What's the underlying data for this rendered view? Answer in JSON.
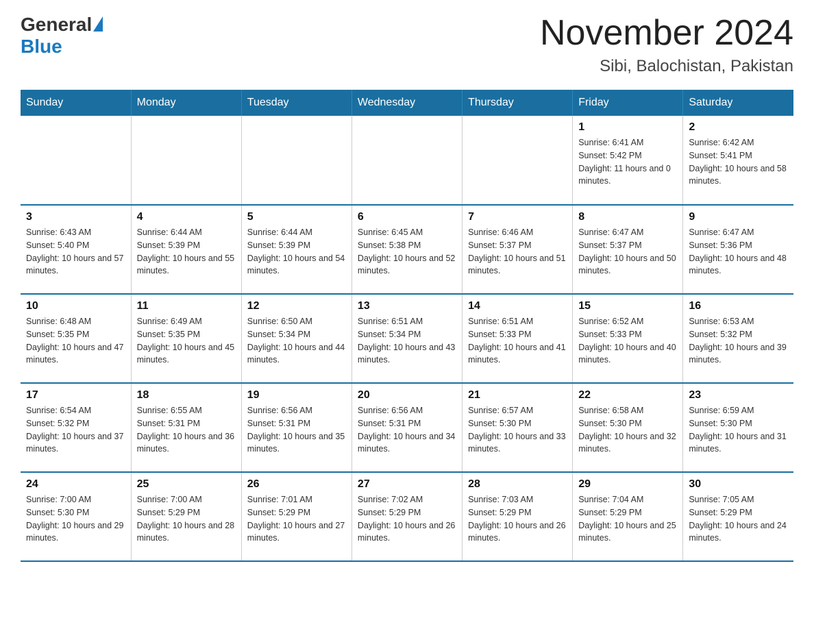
{
  "header": {
    "logo_general": "General",
    "logo_blue": "Blue",
    "month_title": "November 2024",
    "location": "Sibi, Balochistan, Pakistan"
  },
  "days_of_week": [
    "Sunday",
    "Monday",
    "Tuesday",
    "Wednesday",
    "Thursday",
    "Friday",
    "Saturday"
  ],
  "weeks": [
    [
      {
        "day": "",
        "sunrise": "",
        "sunset": "",
        "daylight": ""
      },
      {
        "day": "",
        "sunrise": "",
        "sunset": "",
        "daylight": ""
      },
      {
        "day": "",
        "sunrise": "",
        "sunset": "",
        "daylight": ""
      },
      {
        "day": "",
        "sunrise": "",
        "sunset": "",
        "daylight": ""
      },
      {
        "day": "",
        "sunrise": "",
        "sunset": "",
        "daylight": ""
      },
      {
        "day": "1",
        "sunrise": "Sunrise: 6:41 AM",
        "sunset": "Sunset: 5:42 PM",
        "daylight": "Daylight: 11 hours and 0 minutes."
      },
      {
        "day": "2",
        "sunrise": "Sunrise: 6:42 AM",
        "sunset": "Sunset: 5:41 PM",
        "daylight": "Daylight: 10 hours and 58 minutes."
      }
    ],
    [
      {
        "day": "3",
        "sunrise": "Sunrise: 6:43 AM",
        "sunset": "Sunset: 5:40 PM",
        "daylight": "Daylight: 10 hours and 57 minutes."
      },
      {
        "day": "4",
        "sunrise": "Sunrise: 6:44 AM",
        "sunset": "Sunset: 5:39 PM",
        "daylight": "Daylight: 10 hours and 55 minutes."
      },
      {
        "day": "5",
        "sunrise": "Sunrise: 6:44 AM",
        "sunset": "Sunset: 5:39 PM",
        "daylight": "Daylight: 10 hours and 54 minutes."
      },
      {
        "day": "6",
        "sunrise": "Sunrise: 6:45 AM",
        "sunset": "Sunset: 5:38 PM",
        "daylight": "Daylight: 10 hours and 52 minutes."
      },
      {
        "day": "7",
        "sunrise": "Sunrise: 6:46 AM",
        "sunset": "Sunset: 5:37 PM",
        "daylight": "Daylight: 10 hours and 51 minutes."
      },
      {
        "day": "8",
        "sunrise": "Sunrise: 6:47 AM",
        "sunset": "Sunset: 5:37 PM",
        "daylight": "Daylight: 10 hours and 50 minutes."
      },
      {
        "day": "9",
        "sunrise": "Sunrise: 6:47 AM",
        "sunset": "Sunset: 5:36 PM",
        "daylight": "Daylight: 10 hours and 48 minutes."
      }
    ],
    [
      {
        "day": "10",
        "sunrise": "Sunrise: 6:48 AM",
        "sunset": "Sunset: 5:35 PM",
        "daylight": "Daylight: 10 hours and 47 minutes."
      },
      {
        "day": "11",
        "sunrise": "Sunrise: 6:49 AM",
        "sunset": "Sunset: 5:35 PM",
        "daylight": "Daylight: 10 hours and 45 minutes."
      },
      {
        "day": "12",
        "sunrise": "Sunrise: 6:50 AM",
        "sunset": "Sunset: 5:34 PM",
        "daylight": "Daylight: 10 hours and 44 minutes."
      },
      {
        "day": "13",
        "sunrise": "Sunrise: 6:51 AM",
        "sunset": "Sunset: 5:34 PM",
        "daylight": "Daylight: 10 hours and 43 minutes."
      },
      {
        "day": "14",
        "sunrise": "Sunrise: 6:51 AM",
        "sunset": "Sunset: 5:33 PM",
        "daylight": "Daylight: 10 hours and 41 minutes."
      },
      {
        "day": "15",
        "sunrise": "Sunrise: 6:52 AM",
        "sunset": "Sunset: 5:33 PM",
        "daylight": "Daylight: 10 hours and 40 minutes."
      },
      {
        "day": "16",
        "sunrise": "Sunrise: 6:53 AM",
        "sunset": "Sunset: 5:32 PM",
        "daylight": "Daylight: 10 hours and 39 minutes."
      }
    ],
    [
      {
        "day": "17",
        "sunrise": "Sunrise: 6:54 AM",
        "sunset": "Sunset: 5:32 PM",
        "daylight": "Daylight: 10 hours and 37 minutes."
      },
      {
        "day": "18",
        "sunrise": "Sunrise: 6:55 AM",
        "sunset": "Sunset: 5:31 PM",
        "daylight": "Daylight: 10 hours and 36 minutes."
      },
      {
        "day": "19",
        "sunrise": "Sunrise: 6:56 AM",
        "sunset": "Sunset: 5:31 PM",
        "daylight": "Daylight: 10 hours and 35 minutes."
      },
      {
        "day": "20",
        "sunrise": "Sunrise: 6:56 AM",
        "sunset": "Sunset: 5:31 PM",
        "daylight": "Daylight: 10 hours and 34 minutes."
      },
      {
        "day": "21",
        "sunrise": "Sunrise: 6:57 AM",
        "sunset": "Sunset: 5:30 PM",
        "daylight": "Daylight: 10 hours and 33 minutes."
      },
      {
        "day": "22",
        "sunrise": "Sunrise: 6:58 AM",
        "sunset": "Sunset: 5:30 PM",
        "daylight": "Daylight: 10 hours and 32 minutes."
      },
      {
        "day": "23",
        "sunrise": "Sunrise: 6:59 AM",
        "sunset": "Sunset: 5:30 PM",
        "daylight": "Daylight: 10 hours and 31 minutes."
      }
    ],
    [
      {
        "day": "24",
        "sunrise": "Sunrise: 7:00 AM",
        "sunset": "Sunset: 5:30 PM",
        "daylight": "Daylight: 10 hours and 29 minutes."
      },
      {
        "day": "25",
        "sunrise": "Sunrise: 7:00 AM",
        "sunset": "Sunset: 5:29 PM",
        "daylight": "Daylight: 10 hours and 28 minutes."
      },
      {
        "day": "26",
        "sunrise": "Sunrise: 7:01 AM",
        "sunset": "Sunset: 5:29 PM",
        "daylight": "Daylight: 10 hours and 27 minutes."
      },
      {
        "day": "27",
        "sunrise": "Sunrise: 7:02 AM",
        "sunset": "Sunset: 5:29 PM",
        "daylight": "Daylight: 10 hours and 26 minutes."
      },
      {
        "day": "28",
        "sunrise": "Sunrise: 7:03 AM",
        "sunset": "Sunset: 5:29 PM",
        "daylight": "Daylight: 10 hours and 26 minutes."
      },
      {
        "day": "29",
        "sunrise": "Sunrise: 7:04 AM",
        "sunset": "Sunset: 5:29 PM",
        "daylight": "Daylight: 10 hours and 25 minutes."
      },
      {
        "day": "30",
        "sunrise": "Sunrise: 7:05 AM",
        "sunset": "Sunset: 5:29 PM",
        "daylight": "Daylight: 10 hours and 24 minutes."
      }
    ]
  ]
}
